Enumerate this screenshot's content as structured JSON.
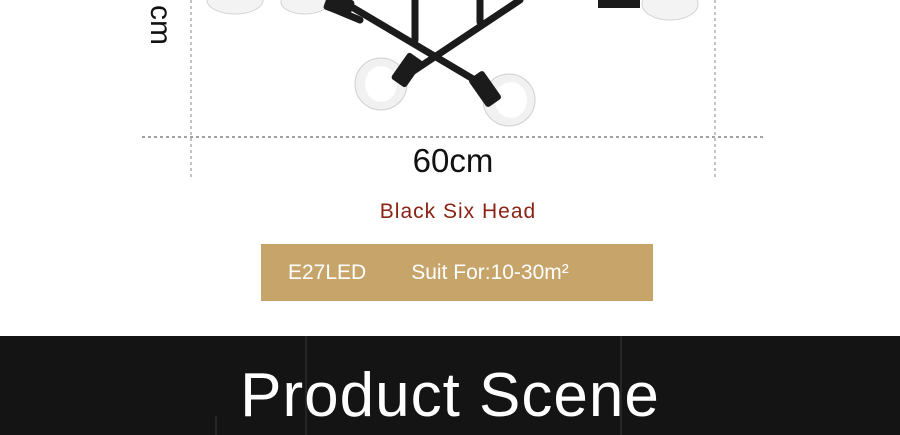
{
  "dimensions": {
    "height_label": "cm",
    "width_label": "60cm"
  },
  "product": {
    "variant": "Black Six Head",
    "bulb_type": "E27LED",
    "suitable_area": "Suit For:10-30m²"
  },
  "banner": {
    "title": "Product Scene"
  },
  "colors": {
    "variant_text": "#8a2314",
    "spec_bar": "#c7a46a",
    "banner_bg": "#141414"
  }
}
